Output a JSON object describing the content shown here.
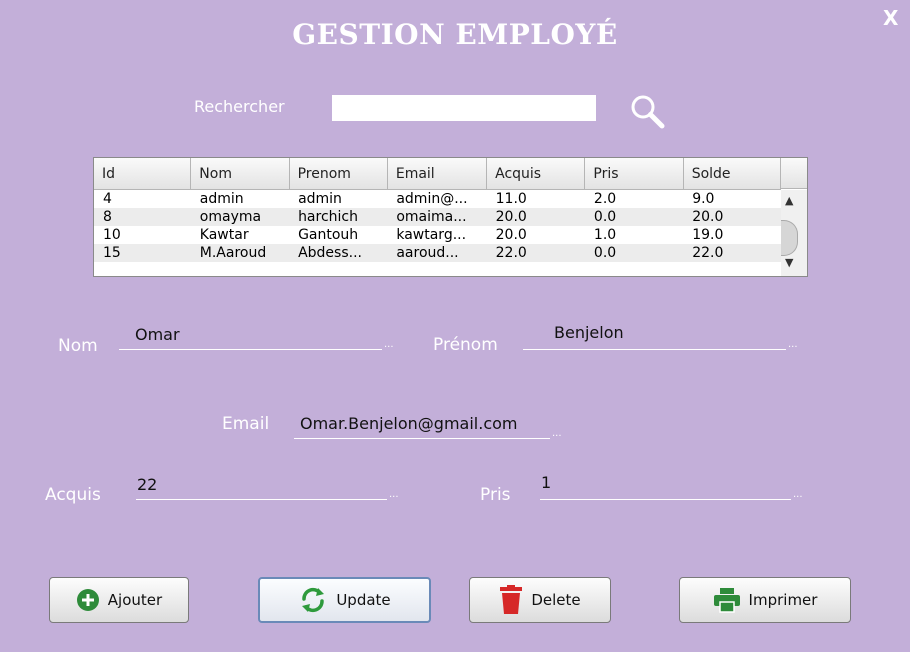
{
  "window": {
    "title": "GESTION EMPLOYÉ",
    "close_label": "X"
  },
  "search": {
    "label": "Rechercher",
    "value": ""
  },
  "table": {
    "columns": [
      "Id",
      "Nom",
      "Prenom",
      "Email",
      "Acquis",
      "Pris",
      "Solde"
    ],
    "rows": [
      [
        "4",
        "admin",
        "admin",
        "admin@...",
        "11.0",
        "2.0",
        "9.0"
      ],
      [
        "8",
        "omayma",
        "harchich",
        "omaima...",
        "20.0",
        "0.0",
        "20.0"
      ],
      [
        "10",
        "Kawtar",
        "Gantouh",
        "kawtarg...",
        "20.0",
        "1.0",
        "19.0"
      ],
      [
        "15",
        "M.Aaroud",
        "Abdess...",
        "aaroud...",
        "22.0",
        "0.0",
        "22.0"
      ]
    ]
  },
  "form": {
    "nom": {
      "label": "Nom",
      "value": "Omar"
    },
    "prenom": {
      "label": "Prénom",
      "value": "Benjelon"
    },
    "email": {
      "label": "Email",
      "value": "Omar.Benjelon@gmail.com"
    },
    "acquis": {
      "label": "Acquis",
      "value": "22"
    },
    "pris": {
      "label": "Pris",
      "value": "1"
    },
    "ellipsis": "..."
  },
  "buttons": {
    "ajouter": "Ajouter",
    "update": "Update",
    "delete": "Delete",
    "imprimer": "Imprimer"
  },
  "colors": {
    "background": "#c3afd9",
    "add_icon": "#2e8b3a",
    "update_icon": "#2e9a3c",
    "delete_icon": "#d62828",
    "print_icon": "#2e8b3a"
  }
}
